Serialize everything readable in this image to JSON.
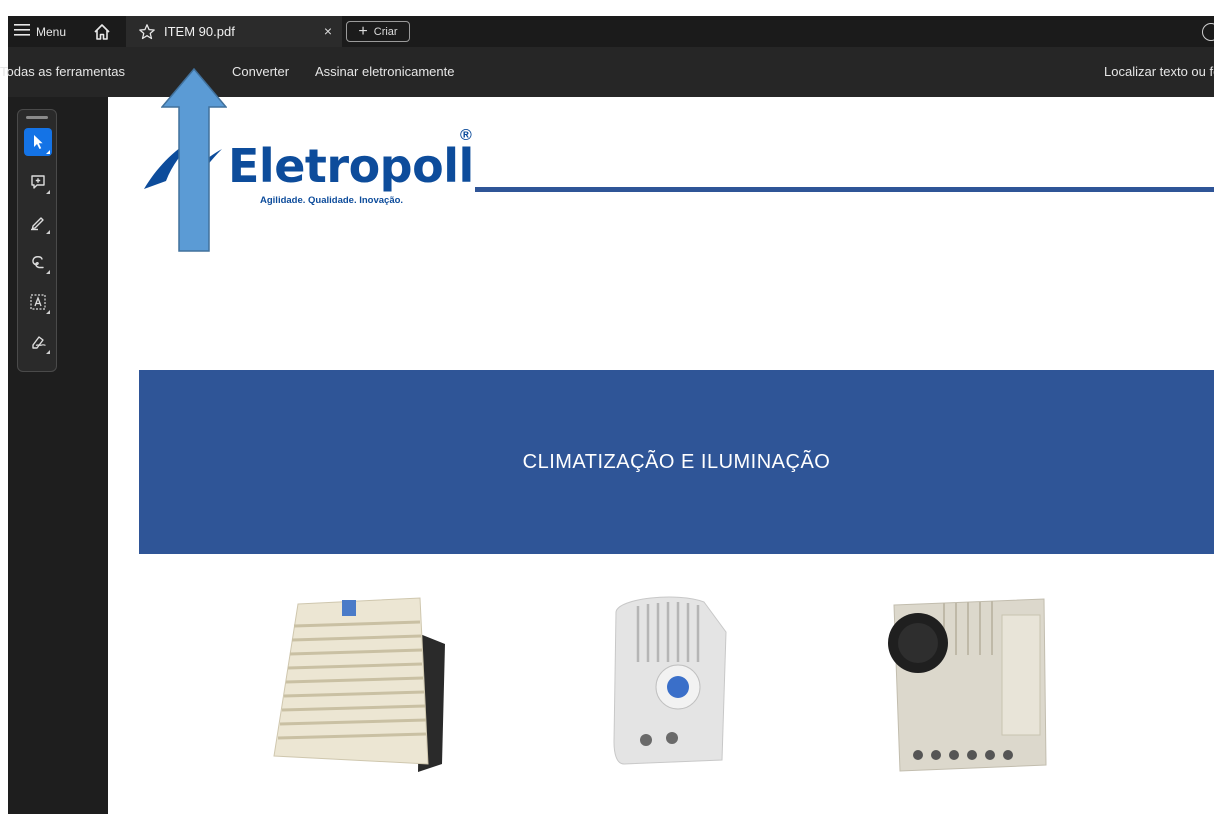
{
  "tabbar": {
    "menu_label": "Menu",
    "tab_title": "ITEM 90.pdf",
    "close_glyph": "×",
    "create_label": "Criar"
  },
  "toolbar": {
    "all_tools": "Todas as ferramentas",
    "convert": "Converter",
    "sign": "Assinar eletronicamente",
    "find_text": "Localizar texto ou fe"
  },
  "tools": [
    {
      "icon": "select-pointer-icon",
      "active": true
    },
    {
      "icon": "add-comment-icon",
      "active": false
    },
    {
      "icon": "highlight-pen-icon",
      "active": false
    },
    {
      "icon": "draw-lasso-icon",
      "active": false
    },
    {
      "icon": "add-text-icon",
      "active": false
    },
    {
      "icon": "sign-pen-icon",
      "active": false
    }
  ],
  "document": {
    "logo_name": "Eletropoll",
    "logo_reg": "®",
    "logo_slogan": "Agilidade. Qualidade. Inovação.",
    "banner_title": "CLIMATIZAÇÃO E ILUMINAÇÃO",
    "products": [
      "fan-filter-grille-image",
      "thermostat-image",
      "hygrostat-controller-image"
    ]
  },
  "colors": {
    "brand_blue": "#0d4c9b",
    "banner_blue": "#2f5597",
    "active_tool": "#1473e6",
    "arrow_fill": "#5b9bd5"
  }
}
